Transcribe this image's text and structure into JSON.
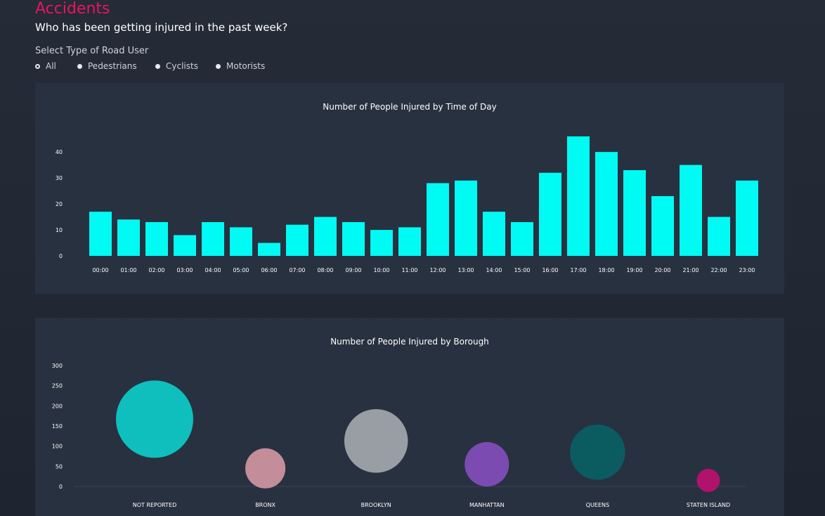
{
  "header": {
    "title": "Accidents",
    "subtitle": "Who has been getting injured in the past week?"
  },
  "filter": {
    "label": "Select Type of Road User",
    "options": [
      "All",
      "Pedestrians",
      "Cyclists",
      "Motorists"
    ],
    "selected": "All"
  },
  "chart_data": [
    {
      "type": "bar",
      "title": "Number of People Injured by Time of Day",
      "xlabel": "",
      "ylabel": "",
      "categories": [
        "00:00",
        "01:00",
        "02:00",
        "03:00",
        "04:00",
        "05:00",
        "06:00",
        "07:00",
        "08:00",
        "09:00",
        "10:00",
        "11:00",
        "12:00",
        "13:00",
        "14:00",
        "15:00",
        "16:00",
        "17:00",
        "18:00",
        "19:00",
        "20:00",
        "21:00",
        "22:00",
        "23:00"
      ],
      "values": [
        17,
        14,
        13,
        8,
        13,
        11,
        5,
        12,
        15,
        13,
        10,
        11,
        28,
        29,
        17,
        13,
        32,
        46,
        40,
        33,
        23,
        35,
        15,
        29
      ],
      "yticks": [
        0,
        10,
        20,
        30,
        40
      ],
      "ylim": [
        0,
        46
      ],
      "color": "#00fbf4",
      "grid": false
    },
    {
      "type": "scatter",
      "subtype": "bubble",
      "title": "Number of People Injured by Borough",
      "xlabel": "",
      "ylabel": "",
      "categories": [
        "NOT REPORTED",
        "BRONX",
        "BROOKLYN",
        "MANHATTAN",
        "QUEENS",
        "STATEN ISLAND"
      ],
      "values": [
        167,
        45,
        113,
        55,
        85,
        15
      ],
      "colors": [
        "#0fbfbd",
        "#c48d9a",
        "#999ea4",
        "#7b4bb1",
        "#0b5c60",
        "#b0126c"
      ],
      "yticks": [
        0,
        50,
        100,
        150,
        200,
        250,
        300
      ],
      "ylim": [
        0,
        300
      ],
      "grid": false
    }
  ]
}
